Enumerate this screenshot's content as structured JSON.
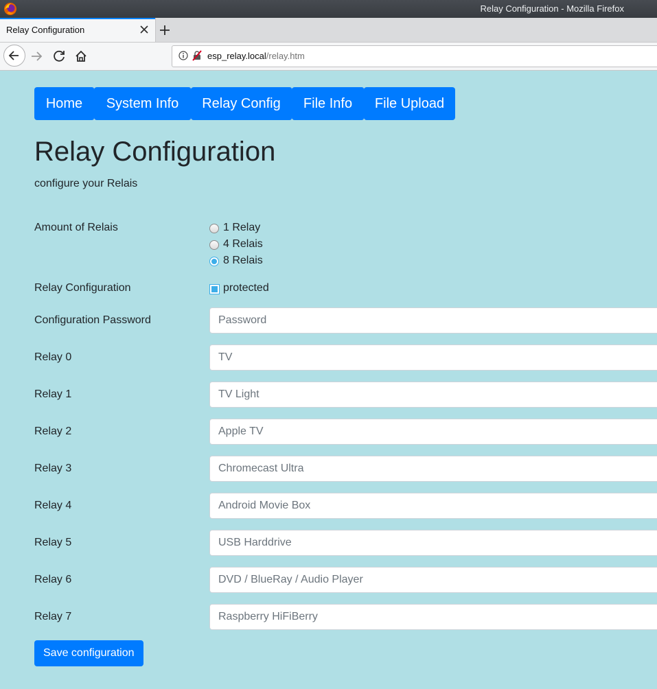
{
  "window": {
    "title": "Relay Configuration - Mozilla Firefox"
  },
  "tab": {
    "label": "Relay Configuration"
  },
  "urlbar": {
    "host": "esp_relay.local",
    "path": "/relay.htm"
  },
  "colors": {
    "page_bg": "#b0dfe5",
    "primary": "#007bff",
    "radio_accent": "#3daee9"
  },
  "nav": {
    "items": [
      {
        "label": "Home"
      },
      {
        "label": "System Info"
      },
      {
        "label": "Relay Config"
      },
      {
        "label": "File Info"
      },
      {
        "label": "File Upload"
      }
    ]
  },
  "page": {
    "title": "Relay Configuration",
    "subtitle": "configure your Relais"
  },
  "form": {
    "amount": {
      "label": "Amount of Relais",
      "options": [
        {
          "label": "1 Relay",
          "checked": false
        },
        {
          "label": "4 Relais",
          "checked": false
        },
        {
          "label": "8 Relais",
          "checked": true
        }
      ]
    },
    "config": {
      "label": "Relay Configuration",
      "checkbox_label": "protected",
      "checked": true
    },
    "password": {
      "label": "Configuration Password",
      "placeholder": "Password"
    },
    "relays": [
      {
        "label": "Relay 0",
        "placeholder": "TV"
      },
      {
        "label": "Relay 1",
        "placeholder": "TV Light"
      },
      {
        "label": "Relay 2",
        "placeholder": "Apple TV"
      },
      {
        "label": "Relay 3",
        "placeholder": "Chromecast Ultra"
      },
      {
        "label": "Relay 4",
        "placeholder": "Android Movie Box"
      },
      {
        "label": "Relay 5",
        "placeholder": "USB Harddrive"
      },
      {
        "label": "Relay 6",
        "placeholder": "DVD / BlueRay / Audio Player"
      },
      {
        "label": "Relay 7",
        "placeholder": "Raspberry HiFiBerry"
      }
    ],
    "save_label": "Save configuration"
  },
  "icons": [
    "firefox-logo-icon",
    "close-tab-icon",
    "new-tab-icon",
    "back-icon",
    "forward-icon",
    "reload-icon",
    "home-icon",
    "info-icon",
    "insecure-lock-icon"
  ]
}
